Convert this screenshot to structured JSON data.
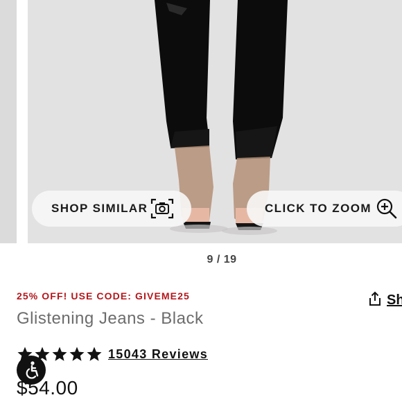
{
  "gallery": {
    "shop_similar_label": "SHOP SIMILAR",
    "click_to_zoom_label": "CLICK TO ZOOM",
    "icons": [
      "camera-icon",
      "zoom-in-icon"
    ]
  },
  "pager": {
    "counter": "9 / 19"
  },
  "product": {
    "promo": "25% OFF! USE CODE: GIVEME25",
    "title": "Glistening Jeans - Black",
    "share_label": "Sh",
    "rating": 5,
    "reviews": "15043 Reviews",
    "price": "$54.00",
    "promo_color": "#b5161b"
  },
  "accessibility": {
    "icon": "accessibility-icon"
  }
}
